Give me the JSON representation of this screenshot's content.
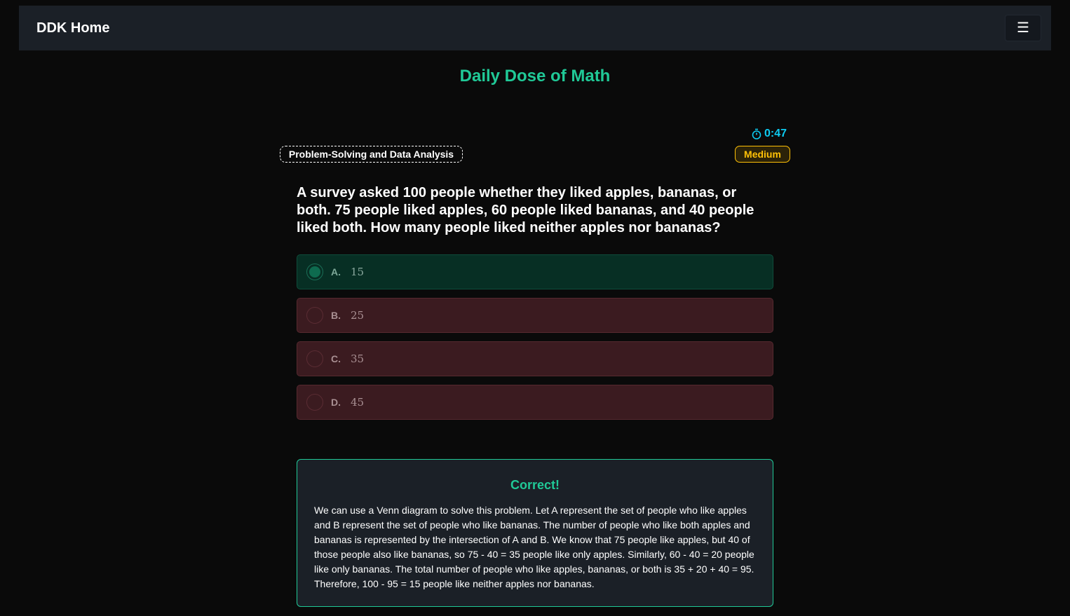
{
  "nav": {
    "brand": "DDK Home",
    "menu_icon": "hamburger-icon"
  },
  "title": "Daily Dose of Math",
  "timer": {
    "value": "0:47",
    "icon": "stopwatch-icon"
  },
  "category": "Problem-Solving and Data Analysis",
  "difficulty": "Medium",
  "question": "A survey asked 100 people whether they liked apples, bananas, or both. 75 people liked apples, 60 people liked bananas, and 40 people liked both. How many people liked neither apples nor bananas?",
  "options": [
    {
      "letter": "A.",
      "text": "15",
      "state": "correct",
      "selected": true
    },
    {
      "letter": "B.",
      "text": "25",
      "state": "wrong",
      "selected": false
    },
    {
      "letter": "C.",
      "text": "35",
      "state": "wrong",
      "selected": false
    },
    {
      "letter": "D.",
      "text": "45",
      "state": "wrong",
      "selected": false
    }
  ],
  "result": {
    "title": "Correct!",
    "explanation": "We can use a Venn diagram to solve this problem. Let A represent the set of people who like apples and B represent the set of people who like bananas. The number of people who like both apples and bananas is represented by the intersection of A and B. We know that 75 people like apples, but 40 of those people also like bananas, so 75 - 40 = 35 people like only apples. Similarly, 60 - 40 = 20 people like only bananas. The total number of people who like apples, bananas, or both is 35 + 20 + 40 = 95. Therefore, 100 - 95 = 15 people like neither apples nor bananas."
  },
  "colors": {
    "accent": "#20c997",
    "timer": "#0dcaf0",
    "medium": "#ffc107",
    "correct_bg": "#072f24",
    "wrong_bg": "#3b1b20"
  }
}
